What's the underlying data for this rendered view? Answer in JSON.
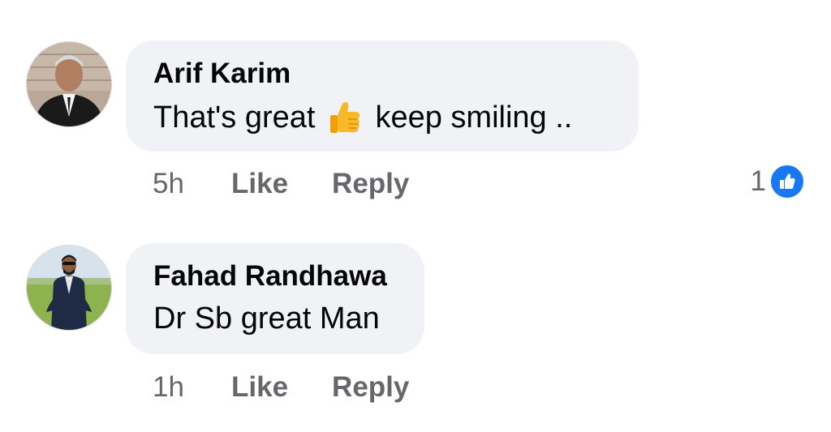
{
  "comments": [
    {
      "author": "Arif Karim",
      "text_before": "That's great",
      "text_after": "keep smiling ..",
      "emoji": "thumbs-up-emoji",
      "time": "5h",
      "like_label": "Like",
      "reply_label": "Reply",
      "reaction_count": "1",
      "reaction_icon": "like-reaction-icon"
    },
    {
      "author": "Fahad Randhawa",
      "text": "Dr Sb great Man",
      "time": "1h",
      "like_label": "Like",
      "reply_label": "Reply"
    }
  ],
  "colors": {
    "bubble": "#f0f2f5",
    "secondary_text": "#65676b",
    "primary_text": "#050505",
    "like_blue": "#1877f2"
  }
}
